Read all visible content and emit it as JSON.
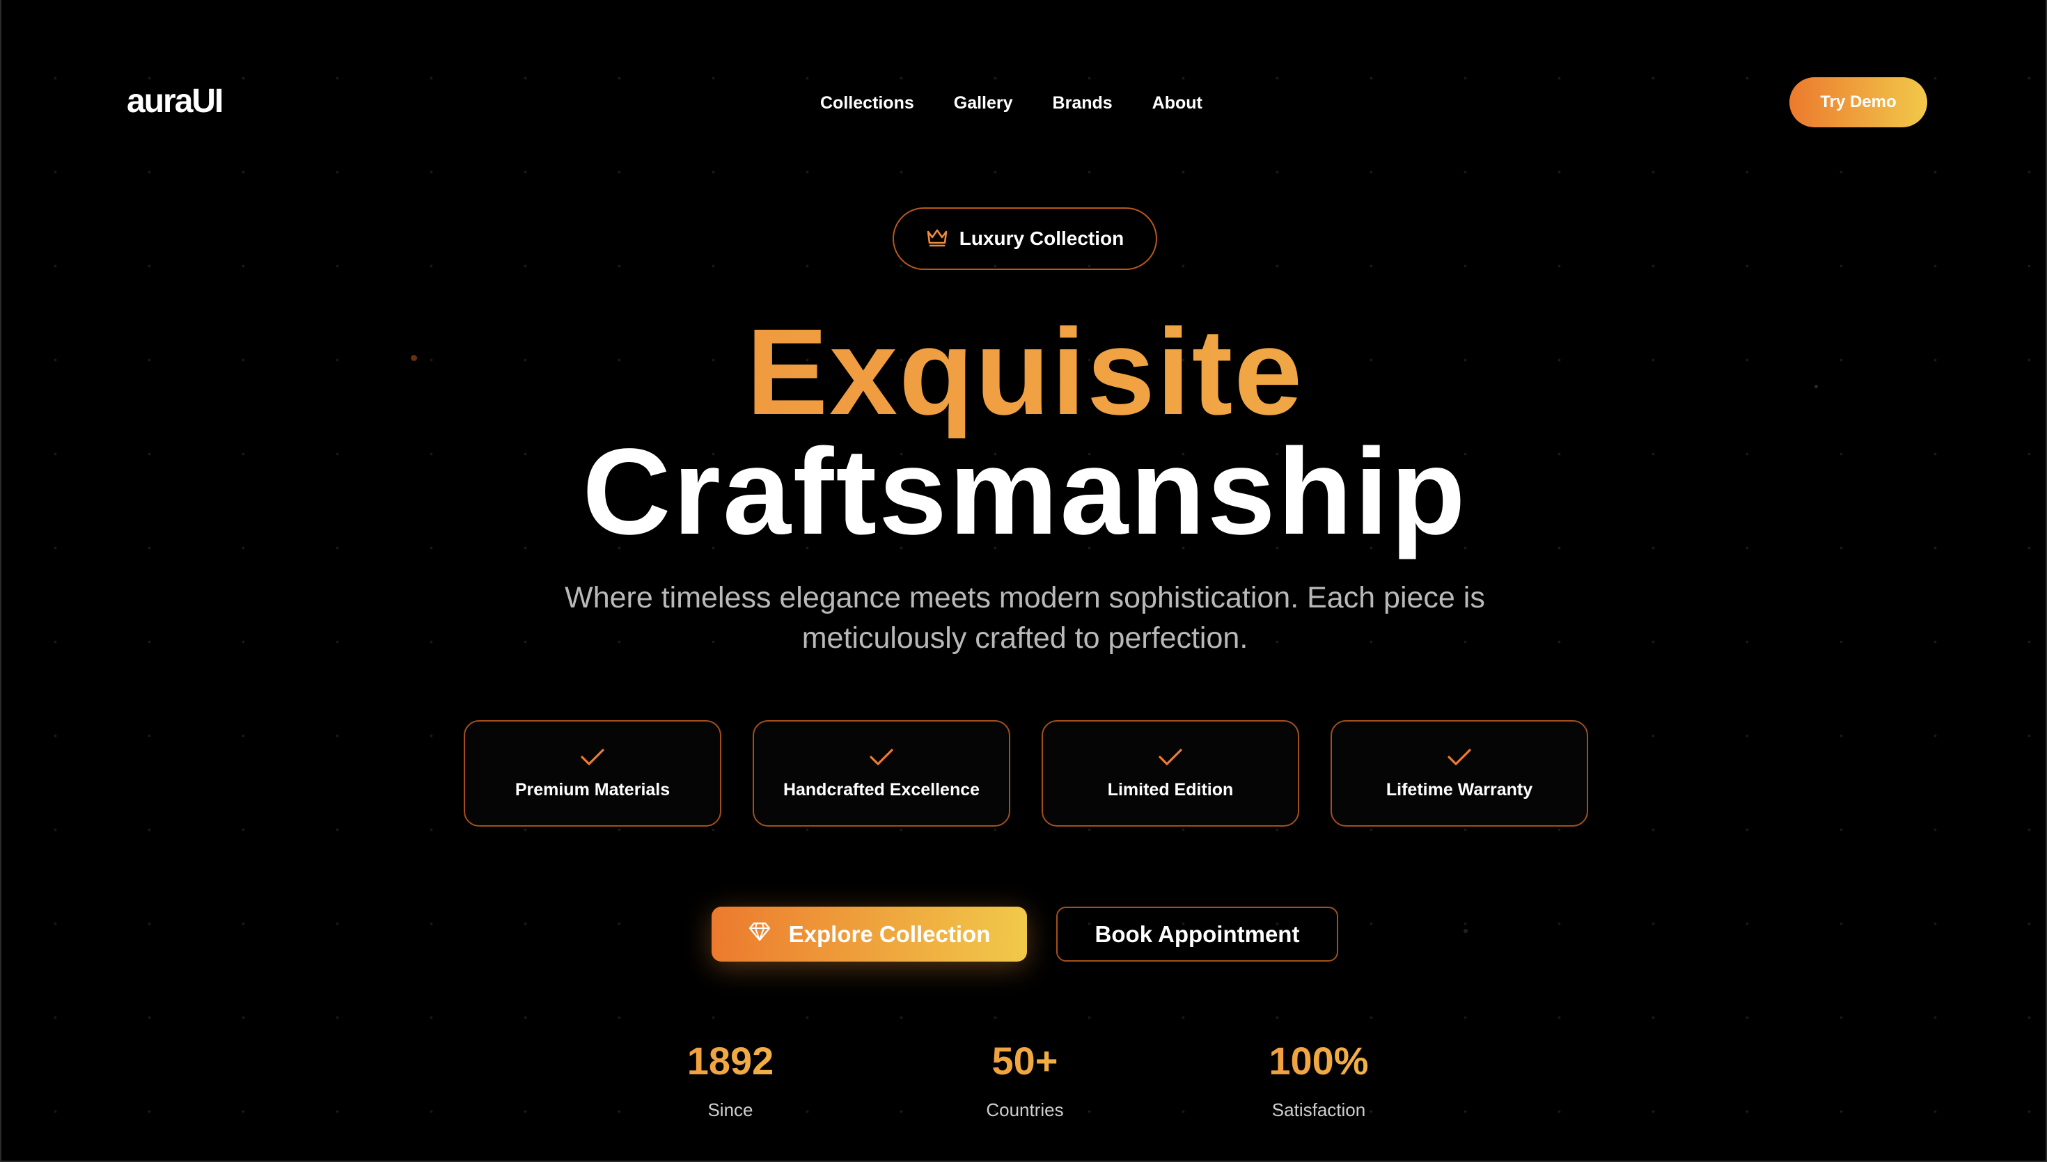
{
  "header": {
    "logo": "auraUI",
    "nav": [
      "Collections",
      "Gallery",
      "Brands",
      "About"
    ],
    "cta_label": "Try Demo"
  },
  "hero": {
    "badge_label": "Luxury Collection",
    "badge_icon": "crown-icon",
    "title_accent": "Exquisite",
    "title_main": "Craftsmanship",
    "subtitle": "Where timeless elegance meets modern sophistication. Each piece is meticulously crafted to perfection."
  },
  "features": [
    {
      "label": "Premium Materials",
      "icon": "check-icon"
    },
    {
      "label": "Handcrafted Excellence",
      "icon": "check-icon"
    },
    {
      "label": "Limited Edition",
      "icon": "check-icon"
    },
    {
      "label": "Lifetime Warranty",
      "icon": "check-icon"
    }
  ],
  "actions": {
    "primary_label": "Explore Collection",
    "primary_icon": "diamond-icon",
    "secondary_label": "Book Appointment"
  },
  "stats": [
    {
      "value": "1892",
      "label": "Since"
    },
    {
      "value": "50+",
      "label": "Countries"
    },
    {
      "value": "100%",
      "label": "Satisfaction"
    }
  ],
  "colors": {
    "accent_start": "#ec7a2e",
    "accent_end": "#f1c94a",
    "border_accent": "#a44f1c",
    "background": "#000000"
  }
}
